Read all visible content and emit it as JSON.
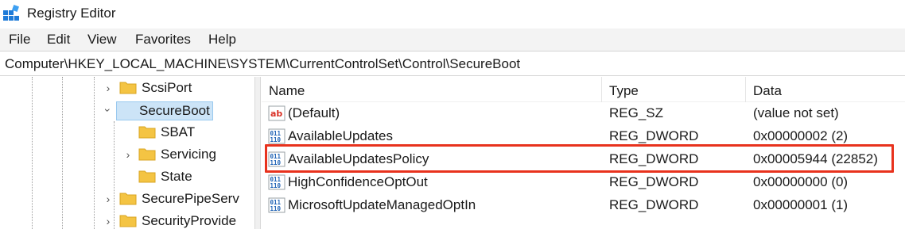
{
  "window": {
    "title": "Registry Editor"
  },
  "menu": [
    "File",
    "Edit",
    "View",
    "Favorites",
    "Help"
  ],
  "address": "Computer\\HKEY_LOCAL_MACHINE\\SYSTEM\\CurrentControlSet\\Control\\SecureBoot",
  "tree": {
    "nodes": [
      {
        "label": "ScsiPort",
        "state": "collapsed",
        "selected": false
      },
      {
        "label": "SecureBoot",
        "state": "expanded",
        "selected": true
      },
      {
        "label": "SBAT",
        "state": "leaf",
        "selected": false
      },
      {
        "label": "Servicing",
        "state": "collapsed",
        "selected": false
      },
      {
        "label": "State",
        "state": "leaf",
        "selected": false
      },
      {
        "label": "SecurePipeServ",
        "state": "collapsed",
        "selected": false
      },
      {
        "label": "SecurityProvide",
        "state": "collapsed",
        "selected": false
      }
    ]
  },
  "values": {
    "columns": {
      "name": "Name",
      "type": "Type",
      "data": "Data"
    },
    "rows": [
      {
        "name": "(Default)",
        "type": "REG_SZ",
        "data": "(value not set)",
        "icon": "string-value-icon"
      },
      {
        "name": "AvailableUpdates",
        "type": "REG_DWORD",
        "data": "0x00000002 (2)",
        "icon": "binary-value-icon"
      },
      {
        "name": "AvailableUpdatesPolicy",
        "type": "REG_DWORD",
        "data": "0x00005944 (22852)",
        "icon": "binary-value-icon",
        "highlighted": true
      },
      {
        "name": "HighConfidenceOptOut",
        "type": "REG_DWORD",
        "data": "0x00000000 (0)",
        "icon": "binary-value-icon"
      },
      {
        "name": "MicrosoftUpdateManagedOptIn",
        "type": "REG_DWORD",
        "data": "0x00000001 (1)",
        "icon": "binary-value-icon"
      }
    ]
  },
  "colors": {
    "highlight": "#e8321d",
    "selection": "#cce4f7",
    "folder": "#f4c443",
    "menubar": "#f3f3f3"
  }
}
